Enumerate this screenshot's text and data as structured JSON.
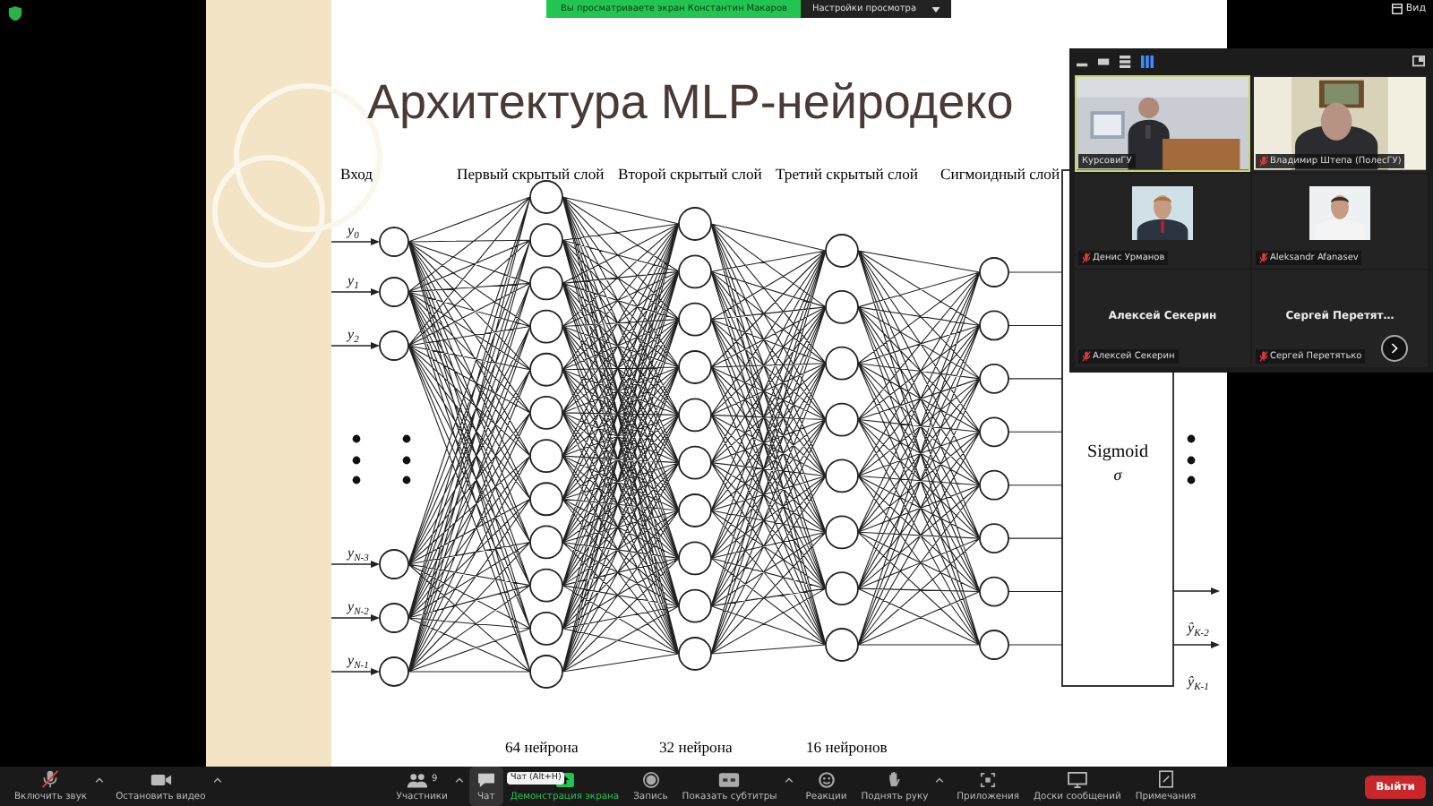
{
  "top_bar": {
    "banner": "Вы просматриваете экран Константин Макаров",
    "view_options": "Настройки просмотра",
    "view_button": "Вид"
  },
  "slide": {
    "title": "Архитектура MLP-нейродеко",
    "layer_labels": [
      "Вход",
      "Первый скрытый слой",
      "Второй скрытый слой",
      "Третий скрытый слой",
      "Сигмоидный слой"
    ],
    "input_labels": [
      {
        "symbol": "y",
        "index": "0"
      },
      {
        "symbol": "y",
        "index": "1"
      },
      {
        "symbol": "y",
        "index": "2"
      },
      {
        "symbol": "y",
        "index": "N-3"
      },
      {
        "symbol": "y",
        "index": "N-2"
      },
      {
        "symbol": "y",
        "index": "N-1"
      }
    ],
    "output_labels": [
      {
        "symbol": "ŷ",
        "index": "K-2"
      },
      {
        "symbol": "ŷ",
        "index": "K-1"
      }
    ],
    "sigmoid_box": {
      "label": "Sigmoid",
      "symbol": "σ"
    },
    "neuron_counts": [
      "64 нейрона",
      "32 нейрона",
      "16 нейронов"
    ]
  },
  "video_panel": {
    "tiles": [
      {
        "kind": "video",
        "name": "КурсовиГУ",
        "muted": false,
        "speaking": true
      },
      {
        "kind": "video",
        "name": "Владимир Штепа (ПолесГУ)",
        "muted": true,
        "speaking": false
      },
      {
        "name": "Денис Урманов",
        "muted": true,
        "speaking": false
      },
      {
        "name": "Aleksandr Afanasev",
        "muted": true,
        "speaking": false
      },
      {
        "kind": "name",
        "display": "Алексей Секерин",
        "name": "Алексей Секерин",
        "muted": true,
        "speaking": false
      },
      {
        "kind": "name",
        "display": "Сергей  Перетят…",
        "name": "Сергей Перетятько",
        "muted": true,
        "speaking": false
      }
    ]
  },
  "toolbar": {
    "left": [
      {
        "kind": "mic-off",
        "label": "Включить звук",
        "caret": true
      },
      {
        "kind": "video",
        "label": "Остановить видео",
        "caret": true
      }
    ],
    "center": [
      {
        "kind": "participants",
        "label": "Участники",
        "count": "9",
        "caret": true,
        "selected": false
      },
      {
        "kind": "chat",
        "label": "Чат",
        "caret": false,
        "selected": true,
        "tooltip": "Чат (Alt+H)"
      },
      {
        "kind": "share",
        "label": "Демонстрация экрана",
        "caret": false,
        "selected": false
      },
      {
        "kind": "record",
        "label": "Запись",
        "caret": false,
        "selected": false
      },
      {
        "kind": "cc",
        "label": "Показать субтитры",
        "caret": true,
        "selected": false
      },
      {
        "kind": "reactions",
        "label": "Реакции",
        "caret": false,
        "selected": false
      },
      {
        "kind": "hand",
        "label": "Поднять руку",
        "caret": true,
        "selected": false
      },
      {
        "kind": "apps",
        "label": "Приложения",
        "caret": false,
        "selected": false
      },
      {
        "kind": "whiteboard",
        "label": "Доски сообщений",
        "caret": false,
        "selected": false
      },
      {
        "kind": "notes",
        "label": "Примечания",
        "caret": false,
        "selected": false
      }
    ],
    "leave": "Выйти"
  }
}
